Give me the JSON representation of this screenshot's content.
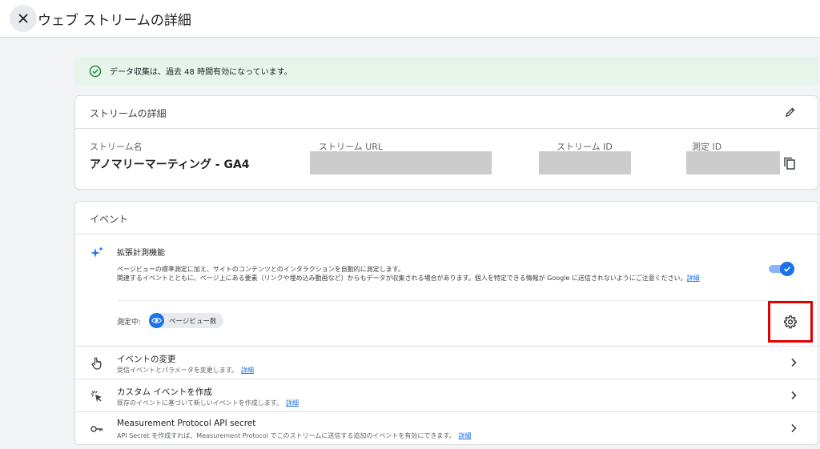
{
  "header": {
    "close_icon": "close-icon",
    "title": "ウェブ ストリームの詳細"
  },
  "alert": {
    "icon": "check-circle-icon",
    "text": "データ収集は、過去 48 時間有効になっています。",
    "color": "#1e8e3e"
  },
  "stream_details": {
    "title": "ストリームの詳細",
    "edit_icon": "pencil-icon",
    "fields": {
      "name_label": "ストリーム名",
      "name_value": "アノマリーマーティング - GA4",
      "url_label": "ストリーム URL",
      "id_label": "ストリーム ID",
      "measurement_id_label": "測定 ID"
    },
    "copy_icon": "copy-icon"
  },
  "events": {
    "title": "イベント",
    "enhanced": {
      "icon": "sparkle-icon",
      "title": "拡張計測機能",
      "desc_line1": "ページビューの標準測定に加え、サイトのコンテンツとのインタラクションを自動的に測定します。",
      "desc_line2": "関連するイベントとともに、ページ上にある要素（リンクや埋め込み動画など）からもデータが収集される場合があります。個人を特定できる情報が Google に送信されないようにご注意ください。",
      "desc_link": "詳細",
      "toggle_on": true,
      "measuring_label": "測定中:",
      "chip_icon": "eye-icon",
      "chip_label": "ページビュー数",
      "settings_icon": "gear-icon"
    },
    "rows": [
      {
        "icon": "touch-icon",
        "title": "イベントの変更",
        "desc": "受信イベントとパラメータを変更します。",
        "link": "詳細"
      },
      {
        "icon": "click-icon",
        "title": "カスタム イベントを作成",
        "desc": "既存のイベントに基づいて新しいイベントを作成します。",
        "link": "詳細"
      },
      {
        "icon": "key-icon",
        "title": "Measurement Protocol API secret",
        "desc": "API Secret を作成すれば、Measurement Protocol でこのストリームに送信する追加のイベントを有効にできます。",
        "link": "詳細"
      }
    ]
  },
  "colors": {
    "accent": "#1a73e8",
    "highlight": "#e00000",
    "alert_bg": "#e6f4ea"
  }
}
